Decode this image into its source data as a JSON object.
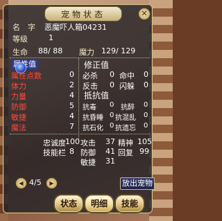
{
  "window": {
    "title": "宠物状态",
    "close_symbol": "✕"
  },
  "pet": {
    "name_label": "名　字",
    "name": "恶魔吓人箱04231"
  },
  "level": {
    "label": "等级",
    "value": "1"
  },
  "hp": {
    "label": "生命",
    "value": "88/ 88"
  },
  "mp": {
    "label": "魔力",
    "value": "129/ 129"
  },
  "attributes": {
    "header": "属性值",
    "items": [
      {
        "label": "属性点数",
        "value": "0"
      },
      {
        "label": "体力",
        "value": "2"
      },
      {
        "label": "力量",
        "value": "4"
      },
      {
        "label": "防御",
        "value": "5"
      },
      {
        "label": "敏捷",
        "value": "4"
      },
      {
        "label": "魔法",
        "value": "7"
      }
    ]
  },
  "modifiers": {
    "header": "修正值",
    "items": [
      {
        "l1": "必杀",
        "v1": "0",
        "l2": "命中",
        "v2": "0"
      },
      {
        "l1": "反击",
        "v1": "0",
        "l2": "闪躲",
        "v2": "0"
      }
    ]
  },
  "resist": {
    "header": "抵抗值",
    "items": [
      {
        "l1": "抗毒",
        "v1": "0",
        "l2": "抗醉",
        "v2": "0"
      },
      {
        "l1": "抗昏睡",
        "v1": "0",
        "l2": "抗混乱",
        "v2": "0"
      },
      {
        "l1": "抗石化",
        "v1": "0",
        "l2": "抗遗忘",
        "v2": "0"
      }
    ]
  },
  "stats": {
    "loyalty_label": "忠诚度",
    "loyalty": "100",
    "skill_slots_label": "技能栏",
    "skill_slots": "8",
    "attack_label": "攻击",
    "attack": "37",
    "defense_label": "防御",
    "defense": "41",
    "agility_label": "敏捷",
    "agility": "31",
    "spirit_label": "精神",
    "spirit": "105",
    "recovery_label": "回复",
    "recovery": "99"
  },
  "pager": {
    "text": "4/5",
    "prev_symbol": "◀",
    "next_symbol": "▶"
  },
  "buttons": {
    "release": "放出宠物",
    "status": "状态",
    "detail": "明细",
    "skills": "技能"
  },
  "colors": {
    "accent_red": "#ff4a40",
    "header_blue": "#2e3a88",
    "gold": "#d8c58a"
  }
}
